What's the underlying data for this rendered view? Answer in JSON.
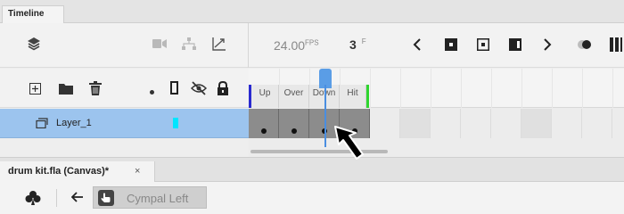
{
  "panel": {
    "tab_label": "Timeline"
  },
  "toolbar": {
    "fps_value": "24.00",
    "fps_unit": "FPS",
    "current_frame": "3",
    "frame_unit": "F",
    "icons": [
      "layers-icon",
      "camera-icon",
      "hierarchy-icon",
      "graph-icon",
      "previous-frame-icon",
      "first-frame-icon",
      "play-icon",
      "last-frame-icon",
      "next-frame-icon",
      "onion-skin-icon",
      "edit-multiple-frames-icon"
    ]
  },
  "layer_header": {
    "icons": [
      "add-layer-icon",
      "add-folder-icon",
      "delete-icon",
      "highlight-dot-icon",
      "outline-icon",
      "hide-icon",
      "lock-icon"
    ]
  },
  "frame_labels": [
    "Up",
    "Over",
    "Down",
    "Hit"
  ],
  "layers": [
    {
      "name": "Layer_1",
      "color": "#00e5ff",
      "selected": true
    }
  ],
  "playhead_frame": 3,
  "document": {
    "tab_label": "drum kit.fla (Canvas)*",
    "close_glyph": "×"
  },
  "editbar": {
    "symbol_name": "Cympal Left"
  },
  "colors": {
    "selected_layer": "#9cc4ee",
    "playhead": "#5a9de6",
    "keyframe": "#8c8c8c",
    "label_start": "#2a2ad0",
    "label_end": "#2fd62f"
  }
}
